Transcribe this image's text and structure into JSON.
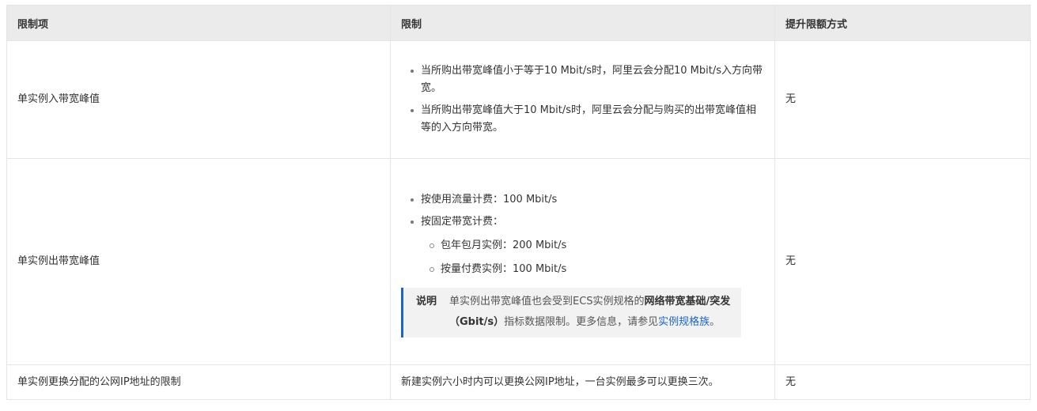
{
  "headers": [
    "限制项",
    "限制",
    "提升限额方式"
  ],
  "rows": [
    {
      "item": "单实例入带宽峰值",
      "limits": [
        "当所购出带宽峰值小于等于10 Mbit/s时，阿里云会分配10 Mbit/s入方向带宽。",
        "当所购出带宽峰值大于10 Mbit/s时，阿里云会分配与购买的出带宽峰值相等的入方向带宽。"
      ],
      "method": "无"
    },
    {
      "item": "单实例出带宽峰值",
      "limits": [
        "按使用流量计费：100 Mbit/s",
        "按固定带宽计费："
      ],
      "sub_limits": [
        "包年包月实例：200 Mbit/s",
        "按量付费实例：100 Mbit/s"
      ],
      "note": {
        "label": "说明",
        "text_before": "单实例出带宽峰值也会受到ECS实例规格的",
        "bold": "网络带宽基础/突发（Gbit/s）",
        "text_middle": "指标数据限制。更多信息，请参见",
        "link": "实例规格族",
        "text_after": "。"
      },
      "method": "无"
    },
    {
      "item": "单实例更换分配的公网IP地址的限制",
      "limit_text": "新建实例六小时内可以更换公网IP地址，一台实例最多可以更换三次。",
      "method": "无"
    }
  ],
  "colors": {
    "header_bg": "#ebebeb",
    "border": "#e5e5e5",
    "note_bg": "#f2f2f2",
    "accent": "#1a66c6"
  }
}
